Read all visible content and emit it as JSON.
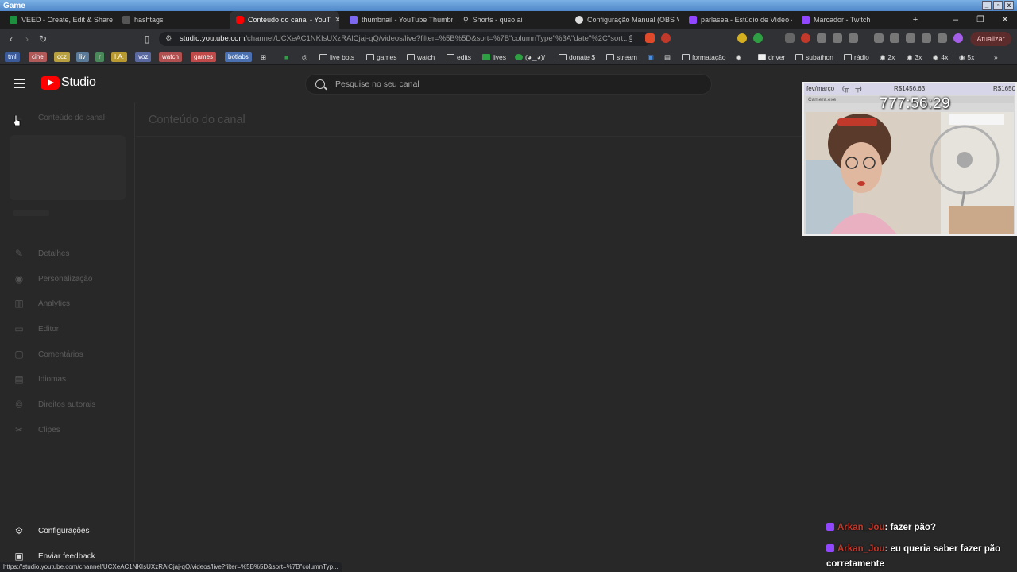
{
  "os": {
    "title": "Game"
  },
  "tabs": [
    {
      "label": "VEED - Create, Edit & Share Vi",
      "color": "#1e8f3f"
    },
    {
      "label": "hashtags",
      "color": "#555555"
    },
    {
      "label": "Conteúdo do canal - YouT",
      "color": "#ff0000"
    },
    {
      "label": "thumbnail - YouTube Thumbn",
      "color": "#7b68ee"
    },
    {
      "label": "Shorts - quso.ai",
      "color": "#777777"
    },
    {
      "label": "Configuração Manual (OBS Ve",
      "color": "#dddddd"
    },
    {
      "label": "parlasea - Estúdio de Vídeo - T",
      "color": "#9147ff"
    },
    {
      "label": "Marcador - Twitch",
      "color": "#9147ff"
    }
  ],
  "address": {
    "host": "studio.youtube.com",
    "path": "/channel/UCXeAC1NKIsUXzRAlCjaj-qQ/videos/live?filter=%5B%5D&sort=%7B\"columnType\"%3A\"date\"%2C\"sort...",
    "update_label": "Atualizar"
  },
  "bookmarks": {
    "chips": [
      {
        "label": "tml",
        "color": "#3a5a9a"
      },
      {
        "label": "cine",
        "color": "#b05a5a"
      },
      {
        "label": "ccz",
        "color": "#b8a040"
      },
      {
        "label": "liv",
        "color": "#5a7a9a"
      },
      {
        "label": "r",
        "color": "#4a8a5a"
      },
      {
        "label": "I.A.",
        "color": "#b89a30"
      },
      {
        "label": "voz",
        "color": "#5a6aa0"
      },
      {
        "label": "watch",
        "color": "#b05050"
      },
      {
        "label": "games",
        "color": "#c04a4a"
      },
      {
        "label": "botlabs",
        "color": "#4a70b0"
      }
    ],
    "items": [
      "live bots",
      "games",
      "watch",
      "edits",
      "lives",
      "(◕‿◕)/",
      "donate $",
      "stream",
      "formatação",
      "driver",
      "subathon",
      "rádio",
      "2x",
      "3x",
      "4x",
      "5x"
    ]
  },
  "studio": {
    "logo_text": "Studio",
    "search_placeholder": "Pesquise no seu canal",
    "page_title": "Conteúdo do canal"
  },
  "sidebar": {
    "back_label": "Conteúdo do canal",
    "items": [
      {
        "label": "Detalhes",
        "icon": "pencil-icon"
      },
      {
        "label": "Personalização",
        "icon": "broadcast-icon"
      },
      {
        "label": "Analytics",
        "icon": "analytics-icon"
      },
      {
        "label": "Editor",
        "icon": "editor-icon"
      },
      {
        "label": "Comentários",
        "icon": "comments-icon"
      },
      {
        "label": "Idiomas",
        "icon": "subtitles-icon"
      },
      {
        "label": "Direitos autorais",
        "icon": "copyright-icon"
      },
      {
        "label": "Clipes",
        "icon": "scissors-icon"
      }
    ],
    "settings_label": "Configurações",
    "feedback_label": "Enviar feedback"
  },
  "overlay": {
    "goal_label": "fev/março",
    "goal_face": "(╥﹏╥)",
    "amount_left": "R$1456.63",
    "amount_right": "R$1650",
    "camera_label": "Camera.exe",
    "timer": "777:56:29"
  },
  "chat": [
    {
      "user": "Arkan_Jou",
      "text": ": fazer pão?"
    },
    {
      "user": "Arkan_Jou",
      "text": ": eu queria saber fazer pão corretamente"
    }
  ],
  "status_url": "https://studio.youtube.com/channel/UCXeAC1NKIsUXzRAlCjaj-qQ/videos/live?filter=%5B%5D&sort=%7B\"columnTyp..."
}
